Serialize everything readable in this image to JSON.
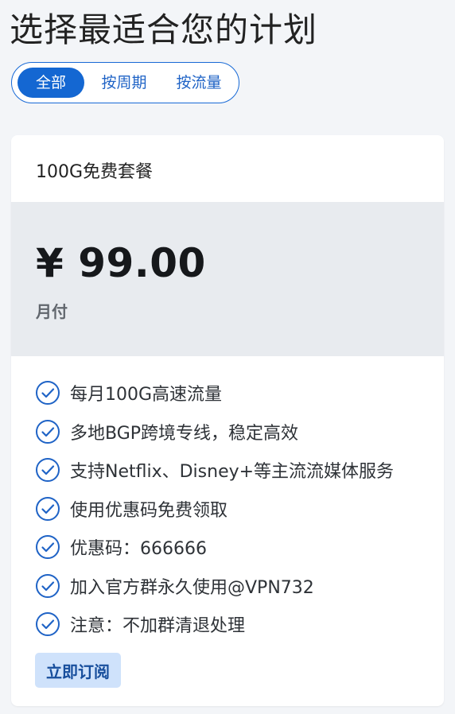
{
  "page": {
    "title": "选择最适合您的计划"
  },
  "filters": {
    "tabs": [
      "全部",
      "按周期",
      "按流量"
    ],
    "active_index": 0
  },
  "plan": {
    "name": "100G免费套餐",
    "price": "¥ 99.00",
    "period": "月付",
    "features": [
      "每月100G高速流量",
      "多地BGP跨境专线，稳定高效",
      "支持Netflix、Disney+等主流流媒体服务",
      "使用优惠码免费领取",
      "优惠码：666666",
      "加入官方群永久使用@VPN732",
      "注意：不加群清退处理"
    ],
    "button_label": "立即订阅"
  },
  "colors": {
    "accent": "#1467d2",
    "button_bg": "#cfe2fb",
    "price_band": "#e8ebef",
    "check": "#1f63c6"
  },
  "icons": {
    "feature": "check-circle-icon"
  }
}
